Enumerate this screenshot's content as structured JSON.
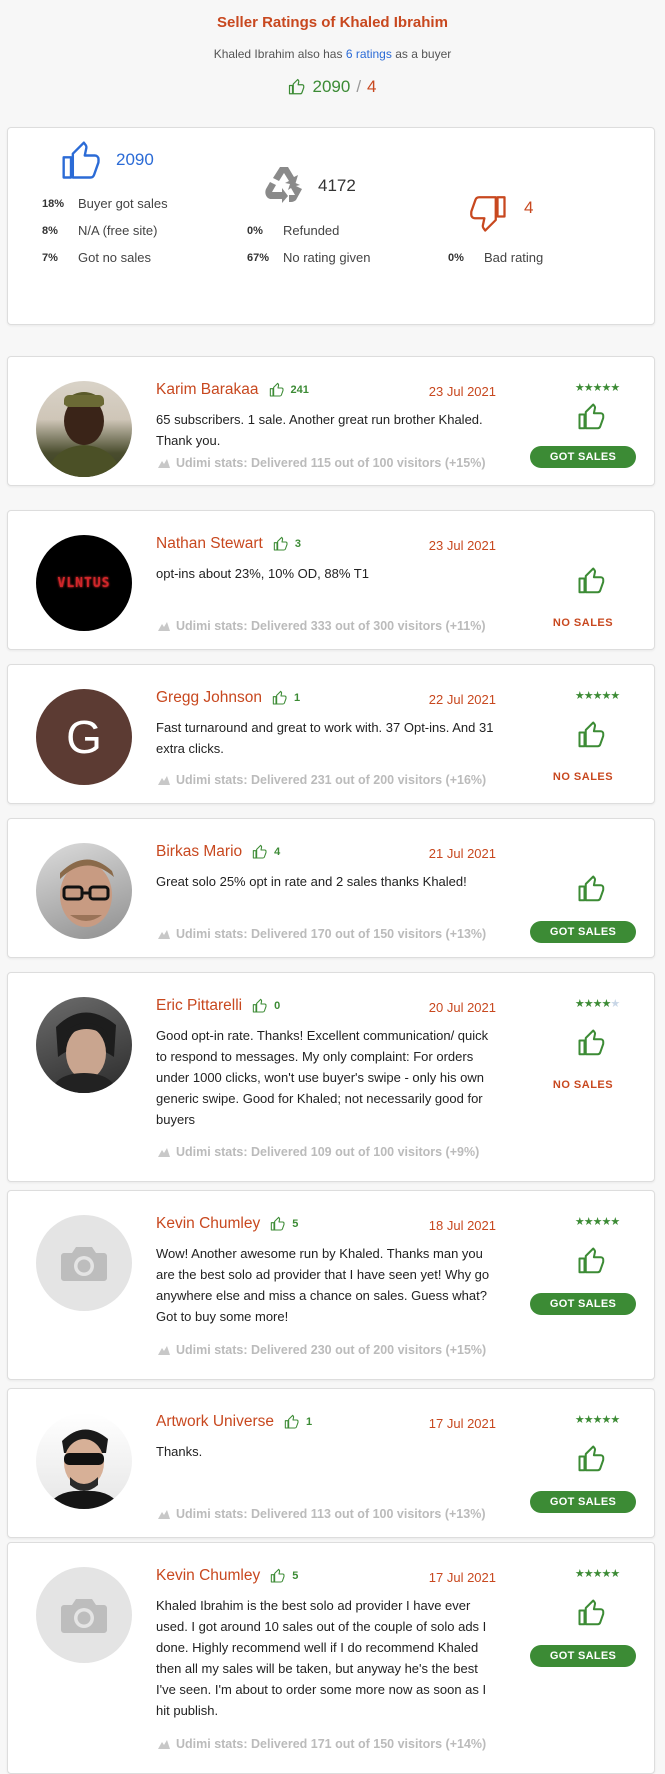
{
  "header": {
    "title": "Seller Ratings of Khaled Ibrahim",
    "subtitle_pre": "Khaled Ibrahim also has",
    "subtitle_link": "6 ratings",
    "subtitle_post": "as a buyer",
    "positive": "2090",
    "slash": "/",
    "negative": "4"
  },
  "summary": {
    "positive_count": "2090",
    "neutral_count": "4172",
    "negative_count": "4",
    "positive_rows": [
      {
        "pct": "18%",
        "label": "Buyer got sales"
      },
      {
        "pct": "8%",
        "label": "N/A (free site)"
      },
      {
        "pct": "7%",
        "label": "Got no sales"
      }
    ],
    "neutral_rows": [
      {
        "pct": "0%",
        "label": "Refunded"
      },
      {
        "pct": "67%",
        "label": "No rating given"
      }
    ],
    "negative_rows": [
      {
        "pct": "0%",
        "label": "Bad rating"
      }
    ]
  },
  "colors": {
    "green": "#3c8b35",
    "orange": "#c8481f",
    "blue": "#2b6bd6"
  },
  "reviews": [
    {
      "name": "Karim Barakaa",
      "likes": "241",
      "date": "23 Jul 2021",
      "comment": "65 subscribers. 1 sale. Another great run brother Khaled. Thank you.",
      "stats": "Udimi stats: Delivered 115 out of 100 visitors (+15%)",
      "stars": 5,
      "stars_shown": true,
      "sales": "GOT SALES",
      "got_sales": true,
      "avatar": "photo-black-man-kufi"
    },
    {
      "name": "Nathan Stewart",
      "likes": "3",
      "date": "23 Jul 2021",
      "comment": "opt-ins about 23%, 10% OD, 88% T1",
      "stats": "Udimi stats: Delivered 333 out of 300 visitors (+11%)",
      "stars": 0,
      "stars_shown": false,
      "sales": "NO SALES",
      "got_sales": false,
      "avatar": "logo-black-red",
      "avatar_text": "VLNTUS"
    },
    {
      "name": "Gregg Johnson",
      "likes": "1",
      "date": "22 Jul 2021",
      "comment": "Fast turnaround and great to work with. 37 Opt-ins. And 31 extra clicks.",
      "stats": "Udimi stats: Delivered 231 out of 200 visitors (+16%)",
      "stars": 5,
      "stars_shown": true,
      "sales": "NO SALES",
      "got_sales": false,
      "avatar": "letter",
      "avatar_text": "G"
    },
    {
      "name": "Birkas Mario",
      "likes": "4",
      "date": "21 Jul 2021",
      "comment": "Great solo 25% opt in rate and 2 sales thanks Khaled!",
      "stats": "Udimi stats: Delivered 170 out of 150 visitors (+13%)",
      "stars": 0,
      "stars_shown": false,
      "sales": "GOT SALES",
      "got_sales": true,
      "avatar": "photo-man-glasses"
    },
    {
      "name": "Eric Pittarelli",
      "likes": "0",
      "date": "20 Jul 2021",
      "comment": "Good opt-in rate. Thanks! Excellent communication/ quick to respond to messages. My only complaint: For orders under 1000 clicks, won't use buyer's swipe - only his own generic swipe. Good for Khaled; not necessarily good for buyers",
      "stats": "Udimi stats: Delivered 109 out of 100 visitors (+9%)",
      "stars": 4,
      "stars_shown": true,
      "sales": "NO SALES",
      "got_sales": false,
      "avatar": "photo-man-dark"
    },
    {
      "name": "Kevin Chumley",
      "likes": "5",
      "date": "18 Jul 2021",
      "comment": "Wow! Another awesome run by Khaled. Thanks man you are the best solo ad provider that I have seen yet! Why go anywhere else and miss a chance on sales. Guess what? Got to buy some more!",
      "stats": "Udimi stats: Delivered 230 out of 200 visitors (+15%)",
      "stars": 5,
      "stars_shown": true,
      "sales": "GOT SALES",
      "got_sales": true,
      "avatar": "camera-placeholder"
    },
    {
      "name": "Artwork Universe",
      "likes": "1",
      "date": "17 Jul 2021",
      "comment": "Thanks.",
      "stats": "Udimi stats: Delivered 113 out of 100 visitors (+13%)",
      "stars": 5,
      "stars_shown": true,
      "sales": "GOT SALES",
      "got_sales": true,
      "avatar": "photo-man-sunglasses"
    },
    {
      "name": "Kevin Chumley",
      "likes": "5",
      "date": "17 Jul 2021",
      "comment": "Khaled Ibrahim is the best solo ad provider I have ever used. I got around 10 sales out of the couple of solo ads I done. Highly recommend well if I do recommend Khaled then all my sales will be taken, but anyway he's the best I've seen. I'm about to order some more now as soon as I hit publish.",
      "stats": "Udimi stats: Delivered 171 out of 150 visitors (+14%)",
      "stars": 5,
      "stars_shown": true,
      "sales": "GOT SALES",
      "got_sales": true,
      "avatar": "camera-placeholder"
    }
  ]
}
